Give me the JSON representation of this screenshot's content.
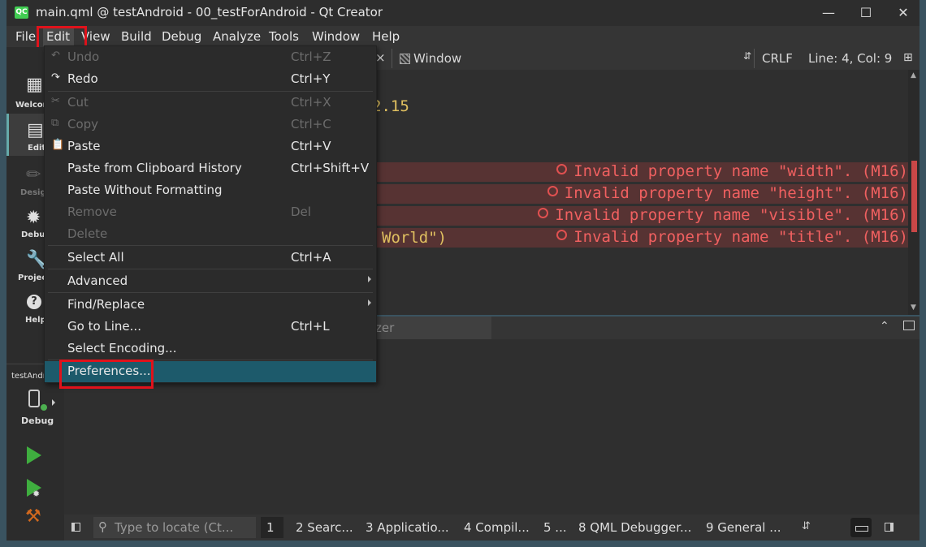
{
  "window": {
    "title": "main.qml @ testAndroid - 00_testForAndroid - Qt Creator",
    "logo_text": "QC"
  },
  "menubar": [
    "File",
    "Edit",
    "View",
    "Build",
    "Debug",
    "Analyze",
    "Tools",
    "Window",
    "Help"
  ],
  "modes": [
    "Welcome",
    "Edit",
    "Design",
    "Debug",
    "Projects",
    "Help"
  ],
  "target": {
    "project": "testAndroid",
    "config": "Debug"
  },
  "editor_toolbar": {
    "close": "×",
    "symbol": "Window",
    "line_ending": "CRLF",
    "position": "Line: 4, Col: 9"
  },
  "code": {
    "line1": "2.15",
    "line4": "World\")"
  },
  "errors": [
    "Invalid property name \"width\". (M16)",
    "Invalid property name \"height\". (M16)",
    "Invalid property name \"visible\". (M16)",
    "Invalid property name \"title\". (M16)"
  ],
  "output_pane": {
    "partial_tab": "zer"
  },
  "statusbar": {
    "locate_placeholder": "Type to locate (Ct...",
    "tabs": [
      "1",
      "2 Searc...",
      "3 Applicatio...",
      "4 Compil...",
      "5 ...",
      "8 QML Debugger...",
      "9 General ..."
    ]
  },
  "edit_menu": [
    {
      "label": "Undo",
      "shortcut": "Ctrl+Z",
      "icon": "undo-icon",
      "disabled": true
    },
    {
      "label": "Redo",
      "shortcut": "Ctrl+Y",
      "icon": "redo-icon",
      "disabled": false
    },
    {
      "label": "Cut",
      "shortcut": "Ctrl+X",
      "icon": "cut-icon",
      "disabled": true
    },
    {
      "label": "Copy",
      "shortcut": "Ctrl+C",
      "icon": "copy-icon",
      "disabled": true
    },
    {
      "label": "Paste",
      "shortcut": "Ctrl+V",
      "icon": "paste-icon",
      "disabled": false
    },
    {
      "label": "Paste from Clipboard History",
      "shortcut": "Ctrl+Shift+V",
      "disabled": false
    },
    {
      "label": "Paste Without Formatting",
      "shortcut": "",
      "disabled": false
    },
    {
      "label": "Remove",
      "shortcut": "Del",
      "disabled": true
    },
    {
      "label": "Delete",
      "shortcut": "",
      "disabled": true
    },
    {
      "label": "Select All",
      "shortcut": "Ctrl+A",
      "disabled": false
    },
    {
      "label": "Advanced",
      "shortcut": "",
      "submenu": true,
      "disabled": false
    },
    {
      "label": "Find/Replace",
      "shortcut": "",
      "submenu": true,
      "disabled": false
    },
    {
      "label": "Go to Line...",
      "shortcut": "Ctrl+L",
      "disabled": false
    },
    {
      "label": "Select Encoding...",
      "shortcut": "",
      "disabled": false
    },
    {
      "label": "Preferences...",
      "shortcut": "",
      "disabled": false,
      "highlighted": true
    }
  ],
  "colors": {
    "highlight": "#1d5a6b",
    "annotation_red": "#e0121b",
    "error_text": "#f06060",
    "run_green": "#3fae3f"
  }
}
